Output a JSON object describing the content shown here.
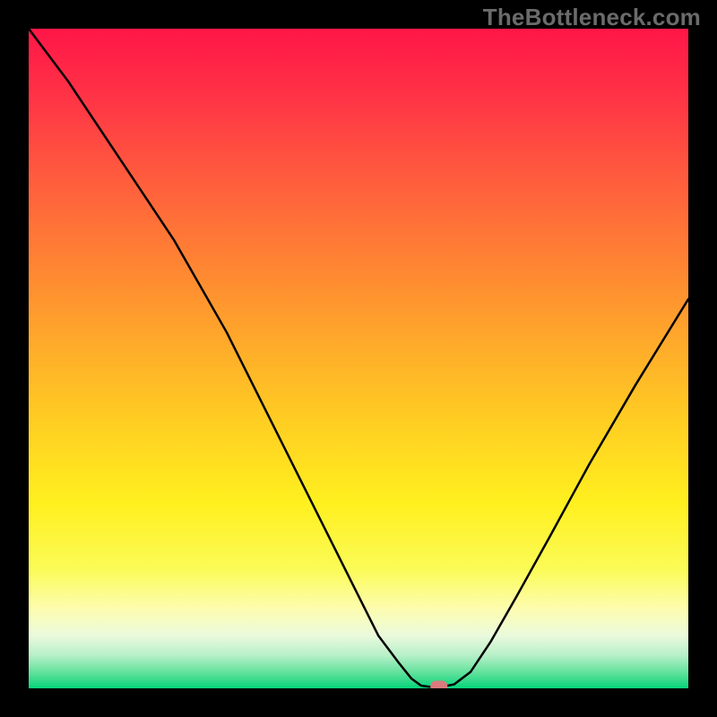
{
  "watermark": "TheBottleneck.com",
  "colors": {
    "curve": "#000000",
    "marker": "#d97a7d"
  },
  "gradient_stops": [
    {
      "offset": 0.0,
      "color": "#ff1647"
    },
    {
      "offset": 0.1,
      "color": "#ff3246"
    },
    {
      "offset": 0.22,
      "color": "#ff5a3e"
    },
    {
      "offset": 0.35,
      "color": "#ff8233"
    },
    {
      "offset": 0.48,
      "color": "#ffab2a"
    },
    {
      "offset": 0.6,
      "color": "#ffcf22"
    },
    {
      "offset": 0.72,
      "color": "#fff01f"
    },
    {
      "offset": 0.82,
      "color": "#fbfb58"
    },
    {
      "offset": 0.88,
      "color": "#fdfdb0"
    },
    {
      "offset": 0.92,
      "color": "#eafadd"
    },
    {
      "offset": 0.95,
      "color": "#b7f0c8"
    },
    {
      "offset": 0.975,
      "color": "#66e29e"
    },
    {
      "offset": 1.0,
      "color": "#06d379"
    }
  ],
  "chart_data": {
    "type": "line",
    "title": "",
    "xlabel": "",
    "ylabel": "",
    "xlim": [
      0,
      100
    ],
    "ylim": [
      0,
      100
    ],
    "x": [
      0,
      6,
      12,
      18,
      22,
      26,
      30,
      34,
      38,
      42,
      46,
      50,
      53,
      56,
      58,
      59.5,
      61,
      62.5,
      64.5,
      67,
      70,
      74,
      79,
      85,
      92,
      100
    ],
    "values": [
      100,
      92,
      83,
      74,
      68,
      61,
      54,
      46,
      38,
      30,
      22,
      14,
      8,
      4,
      1.5,
      0.4,
      0.2,
      0.2,
      0.6,
      2.5,
      7,
      14,
      23,
      34,
      46,
      59
    ],
    "flat_range_x": [
      59.5,
      62.5
    ],
    "marker": {
      "x": 62.2,
      "y": 0.3,
      "w": 2.6,
      "h": 1.7
    }
  }
}
